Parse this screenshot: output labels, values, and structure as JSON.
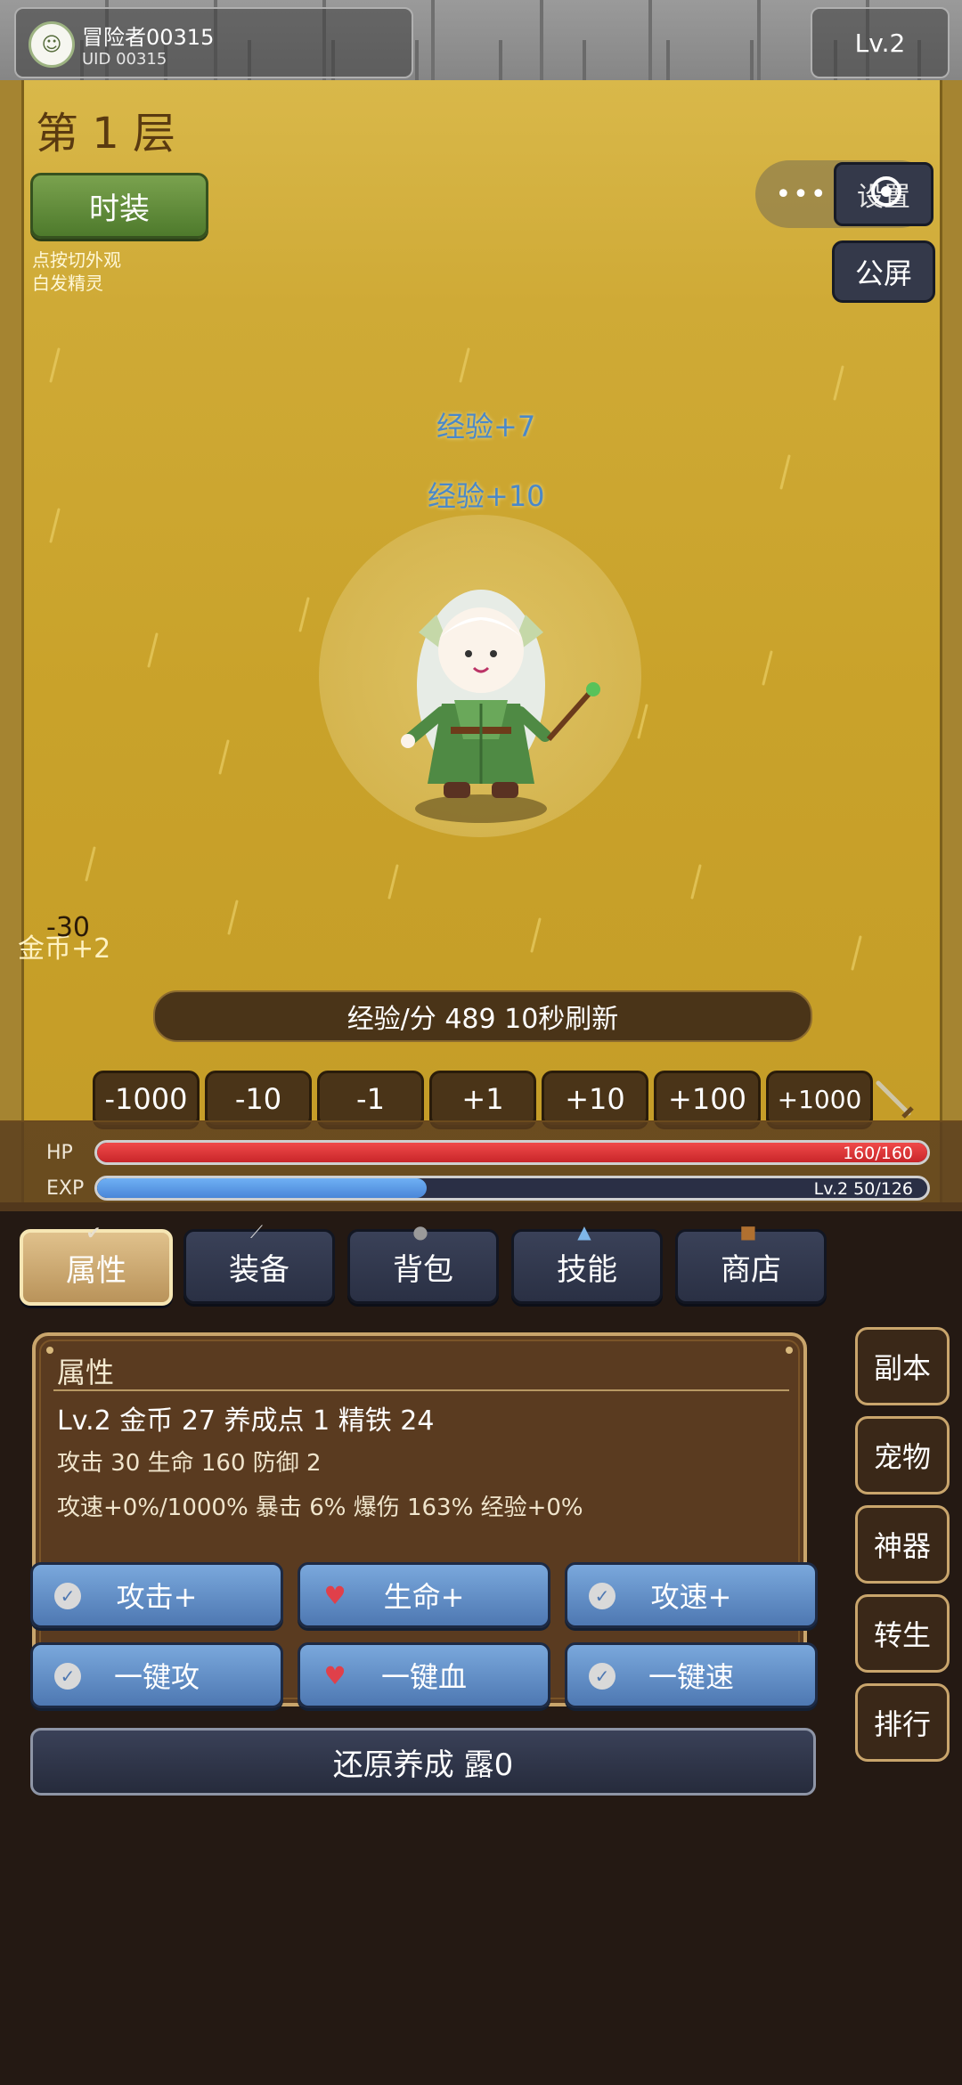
{
  "user": {
    "name": "冒险者00315",
    "uid": "UID 00315",
    "avatar_icon": "smile-face-icon"
  },
  "header": {
    "level": "Lv.2"
  },
  "scene": {
    "floor_title": "第 1 层",
    "costume_label": "时装",
    "costume_hint1": "点按切外观",
    "costume_hint2": "白发精灵",
    "settings_label": "设置",
    "more_dots": "•••",
    "chat_label": "公屏",
    "float_exp1": "经验+7",
    "float_exp2": "经验+10",
    "coin_text": "金币+2",
    "damage_text": "-30",
    "exp_rate": "经验/分 489  10秒刷新",
    "steps": [
      "-1000",
      "-10",
      "-1",
      "+1",
      "+10",
      "+100",
      "+1000"
    ]
  },
  "stats": {
    "hp_label": "HP",
    "hp_text": "160/160",
    "hp_fraction": 1.0,
    "exp_label": "EXP",
    "exp_text": "Lv.2  50/126",
    "exp_fraction": 0.397,
    "hp_color": "#e03a3a",
    "exp_color": "#5a96e0"
  },
  "tabs": [
    {
      "label": "属性",
      "icon": "check-icon",
      "active": true
    },
    {
      "label": "装备",
      "icon": "sword-icon",
      "active": false
    },
    {
      "label": "背包",
      "icon": "bag-icon",
      "active": false
    },
    {
      "label": "技能",
      "icon": "crystal-icon",
      "active": false
    },
    {
      "label": "商店",
      "icon": "shop-bag-icon",
      "active": false
    }
  ],
  "attributes": {
    "title": "属性",
    "line1": "Lv.2  金币 27  养成点 1  精铁 24",
    "line2": "攻击 30  生命 160  防御 2",
    "line3": "攻速+0%/1000%  暴击 6%  爆伤 163%  经验+0%"
  },
  "upgrade_buttons": [
    {
      "label": "攻击+",
      "icon": "check-icon"
    },
    {
      "label": "生命+",
      "icon": "heart-icon"
    },
    {
      "label": "攻速+",
      "icon": "check-icon"
    },
    {
      "label": "一键攻",
      "icon": "check-icon"
    },
    {
      "label": "一键血",
      "icon": "heart-icon"
    },
    {
      "label": "一键速",
      "icon": "check-icon"
    }
  ],
  "reset_label": "还原养成 露0",
  "side_menu": [
    "副本",
    "宠物",
    "神器",
    "转生",
    "排行"
  ]
}
